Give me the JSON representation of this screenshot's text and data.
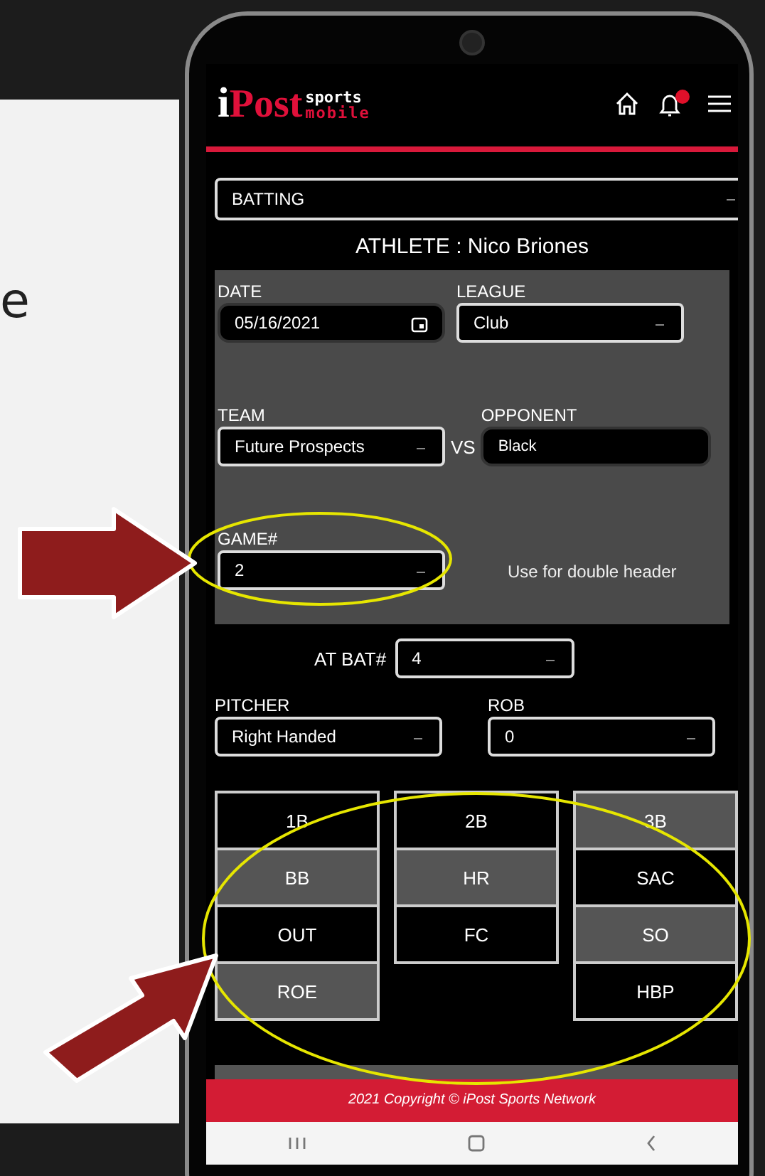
{
  "slide": {
    "text_fragment": "e"
  },
  "app": {
    "logo": {
      "prefix": "i",
      "main": "Post",
      "top": "sports",
      "bottom": "mobile"
    },
    "category_select": {
      "value": "BATTING"
    },
    "athlete": "ATHLETE : Nico Briones",
    "date": {
      "label": "DATE",
      "value": "05/16/2021"
    },
    "league": {
      "label": "LEAGUE",
      "value": "Club"
    },
    "team": {
      "label": "TEAM",
      "value": "Future Prospects"
    },
    "vs": "VS",
    "opponent": {
      "label": "OPPONENT",
      "value": "Black"
    },
    "game": {
      "label": "GAME#",
      "value": "2"
    },
    "game_note": "Use for double header",
    "at_bat": {
      "label": "AT BAT#",
      "value": "4"
    },
    "pitcher": {
      "label": "PITCHER",
      "value": "Right Handed"
    },
    "rob": {
      "label": "ROB",
      "value": "0"
    },
    "result_columns": [
      [
        {
          "label": "1B",
          "shaded": false
        },
        {
          "label": "BB",
          "shaded": true
        },
        {
          "label": "OUT",
          "shaded": false
        },
        {
          "label": "ROE",
          "shaded": true
        }
      ],
      [
        {
          "label": "2B",
          "shaded": false
        },
        {
          "label": "HR",
          "shaded": true
        },
        {
          "label": "FC",
          "shaded": false
        }
      ],
      [
        {
          "label": "3B",
          "shaded": true
        },
        {
          "label": "SAC",
          "shaded": false
        },
        {
          "label": "SO",
          "shaded": true
        },
        {
          "label": "HBP",
          "shaded": false
        }
      ]
    ],
    "footer": "2021 Copyright © iPost Sports Network"
  }
}
